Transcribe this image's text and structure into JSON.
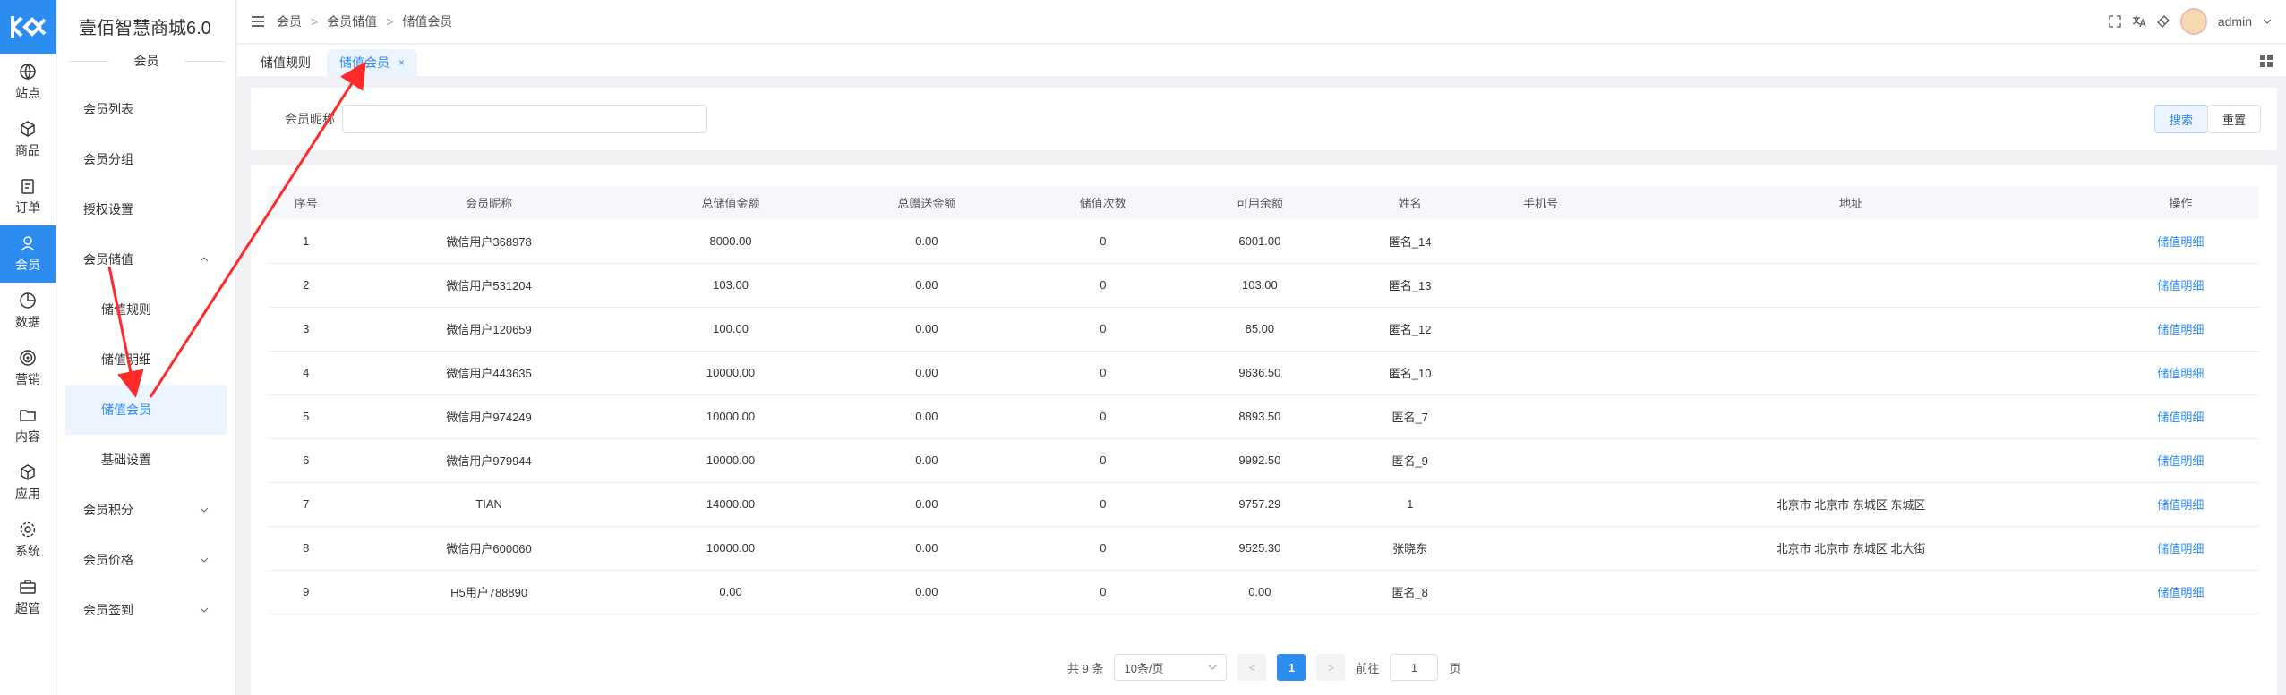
{
  "app": {
    "title": "壹佰智慧商城6.0",
    "section": "会员"
  },
  "rail": [
    {
      "label": "站点",
      "icon": "globe-icon"
    },
    {
      "label": "商品",
      "icon": "box-icon"
    },
    {
      "label": "订单",
      "icon": "clipboard-icon"
    },
    {
      "label": "会员",
      "icon": "user-icon",
      "active": true
    },
    {
      "label": "数据",
      "icon": "pie-chart-icon"
    },
    {
      "label": "营销",
      "icon": "target-icon"
    },
    {
      "label": "内容",
      "icon": "folder-icon"
    },
    {
      "label": "应用",
      "icon": "cube-icon"
    },
    {
      "label": "系统",
      "icon": "gear-icon"
    },
    {
      "label": "超管",
      "icon": "briefcase-icon"
    }
  ],
  "menu": {
    "member_list": "会员列表",
    "member_group": "会员分组",
    "auth_settings": "授权设置",
    "member_stored": "会员储值",
    "stored_rules": "储值规则",
    "stored_detail": "储值明细",
    "stored_members": "储值会员",
    "basic_settings": "基础设置",
    "member_points": "会员积分",
    "member_price": "会员价格",
    "member_signin": "会员签到"
  },
  "breadcrumb": [
    "会员",
    "会员储值",
    "储值会员"
  ],
  "header": {
    "user": "admin"
  },
  "tabs": [
    {
      "label": "储值规则"
    },
    {
      "label": "储值会员",
      "close": "×"
    }
  ],
  "search": {
    "label": "会员昵称",
    "placeholder": "",
    "search_btn": "搜索",
    "reset_btn": "重置"
  },
  "table": {
    "columns": [
      "序号",
      "会员昵称",
      "总储值金额",
      "总赠送金额",
      "储值次数",
      "可用余额",
      "姓名",
      "手机号",
      "地址",
      "操作"
    ],
    "rows": [
      [
        "1",
        "微信用户368978",
        "8000.00",
        "0.00",
        "0",
        "6001.00",
        "匿名_14",
        "",
        "",
        "储值明细"
      ],
      [
        "2",
        "微信用户531204",
        "103.00",
        "0.00",
        "0",
        "103.00",
        "匿名_13",
        "",
        "",
        "储值明细"
      ],
      [
        "3",
        "微信用户120659",
        "100.00",
        "0.00",
        "0",
        "85.00",
        "匿名_12",
        "",
        "",
        "储值明细"
      ],
      [
        "4",
        "微信用户443635",
        "10000.00",
        "0.00",
        "0",
        "9636.50",
        "匿名_10",
        "",
        "",
        "储值明细"
      ],
      [
        "5",
        "微信用户974249",
        "10000.00",
        "0.00",
        "0",
        "8893.50",
        "匿名_7",
        "",
        "",
        "储值明细"
      ],
      [
        "6",
        "微信用户979944",
        "10000.00",
        "0.00",
        "0",
        "9992.50",
        "匿名_9",
        "",
        "",
        "储值明细"
      ],
      [
        "7",
        "TIAN",
        "14000.00",
        "0.00",
        "0",
        "9757.29",
        "1",
        "",
        "北京市 北京市 东城区 东城区",
        "储值明细"
      ],
      [
        "8",
        "微信用户600060",
        "10000.00",
        "0.00",
        "0",
        "9525.30",
        "张晓东",
        "",
        "北京市 北京市 东城区 北大街",
        "储值明细"
      ],
      [
        "9",
        "H5用户788890",
        "0.00",
        "0.00",
        "0",
        "0.00",
        "匿名_8",
        "",
        "",
        "储值明细"
      ]
    ]
  },
  "pagination": {
    "total": "共 9 条",
    "page_size": "10条/页",
    "prev": "<",
    "current": "1",
    "next": ">",
    "goto_label": "前往",
    "goto_value": "1",
    "page_unit": "页"
  },
  "colors": {
    "primary": "#2d8cf0",
    "annotation": "#ff2a2a"
  }
}
